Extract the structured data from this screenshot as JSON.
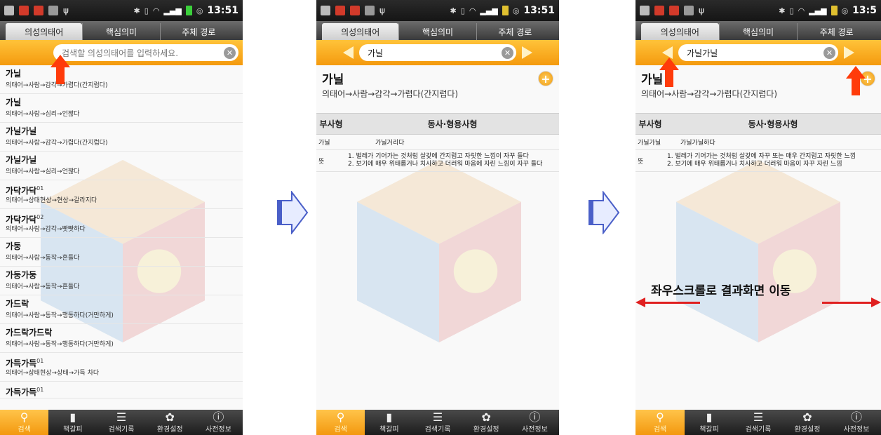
{
  "status_bar": {
    "time": "13:51",
    "time_cut": "13:5"
  },
  "tabs": [
    "의성의태어",
    "핵심의미",
    "주체 경로"
  ],
  "search": {
    "placeholder": "검색할 의성의태어를 입력하세요."
  },
  "list": [
    {
      "word": "가닐",
      "sup": "",
      "category": "의태어→사람→감각→가렵다(간지럽다)"
    },
    {
      "word": "가닐",
      "sup": "",
      "category": "의태어→사람→심리→언짢다"
    },
    {
      "word": "가닐가닐",
      "sup": "",
      "category": "의태어→사람→감각→가렵다(간지럽다)"
    },
    {
      "word": "가닐가닐",
      "sup": "",
      "category": "의태어→사람→심리→언짢다"
    },
    {
      "word": "가닥가닥",
      "sup": "01",
      "category": "의태어→상태현상→현상→갈라지다"
    },
    {
      "word": "가닥가닥",
      "sup": "02",
      "category": "의태어→사람→감각→빳빳하다"
    },
    {
      "word": "가둥",
      "sup": "",
      "category": "의태어→사람→동작→흔들다"
    },
    {
      "word": "가둥가둥",
      "sup": "",
      "category": "의태어→사람→동작→흔들다"
    },
    {
      "word": "가드락",
      "sup": "",
      "category": "의태어→사람→동작→행동하다(거만하게)"
    },
    {
      "word": "가드락가드락",
      "sup": "",
      "category": "의태어→사람→동작→행동하다(거만하게)"
    },
    {
      "word": "가득가득",
      "sup": "01",
      "category": "의태어→상태현상→상태→가득 차다"
    },
    {
      "word": "가득가득",
      "sup": "01",
      "category": ""
    }
  ],
  "detail1": {
    "search_value": "가닐",
    "word": "가닐",
    "category": "의태어→사람→감각→가렵다(간지럽다)",
    "col1": "부사형",
    "col2": "동사·형용사형",
    "adverb": "가닐",
    "verb": "가닐거리다",
    "meaning_label": "뜻",
    "meaning": "1. 벌레가 기어가는 것처럼 살갗에 간지럽고 자릿한 느낌이 자꾸 들다\n2. 보기에 매우 위태롭거나 치사하고 더러워 마음에 자린 느낌이 자꾸 들다"
  },
  "detail2": {
    "search_value": "가닐가닐",
    "word": "가닐",
    "category": "의태어→사람→감각→가렵다(간지럽다)",
    "col1": "부사형",
    "col2": "동사·형용사형",
    "adverb": "가닐가닐",
    "verb": "가닐가닐하다",
    "meaning_label": "뜻",
    "meaning": "1. 벌레가 기어가는 것처럼 살갗에 자꾸 또는 매우 간지럽고 자릿한 느낌\n2. 보기에 매우 위태롭거나 치사하고 더러워 마음이 자꾸 자린 느낌"
  },
  "bottom_nav": [
    {
      "label": "검색",
      "icon": "search-icon"
    },
    {
      "label": "책갈피",
      "icon": "bookmark-icon"
    },
    {
      "label": "검색기록",
      "icon": "history-icon"
    },
    {
      "label": "환경설정",
      "icon": "gear-icon"
    },
    {
      "label": "사전정보",
      "icon": "info-icon"
    }
  ],
  "annotation": {
    "text": "좌우스크롤로 결과화면 이동"
  },
  "colors": {
    "accent": "#f49a0e",
    "annotation_red": "#e02020",
    "flow_arrow": "#4a5fc8"
  }
}
